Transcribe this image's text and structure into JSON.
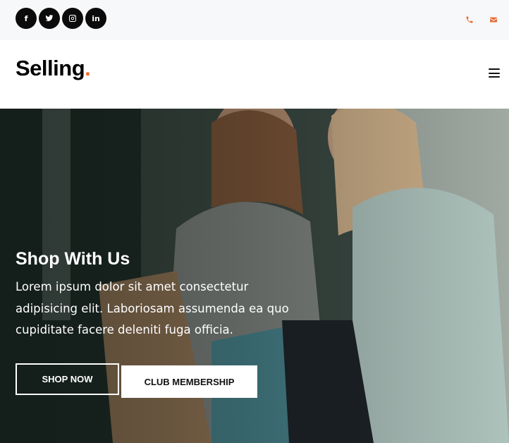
{
  "topbar": {
    "social": [
      {
        "icon": "facebook-icon",
        "glyph": "f"
      },
      {
        "icon": "twitter-icon",
        "glyph": ""
      },
      {
        "icon": "instagram-icon",
        "glyph": ""
      },
      {
        "icon": "linkedin-icon",
        "glyph": "in"
      }
    ],
    "contact": [
      {
        "icon": "phone-icon"
      },
      {
        "icon": "envelope-icon"
      }
    ],
    "accent_color": "#e8703a"
  },
  "header": {
    "logo_text": "Selling",
    "logo_dot": ".",
    "logo_dot_color": "#f26b2a",
    "menu_icon": "hamburger-menu-icon"
  },
  "hero": {
    "title": "Shop With Us",
    "text": "Lorem ipsum dolor sit amet consectetur adipisicing elit. Laboriosam assumenda ea quo cupiditate facere deleniti fuga officia.",
    "primary_button": "SHOP NOW",
    "secondary_button": "CLUB MEMBERSHIP"
  }
}
